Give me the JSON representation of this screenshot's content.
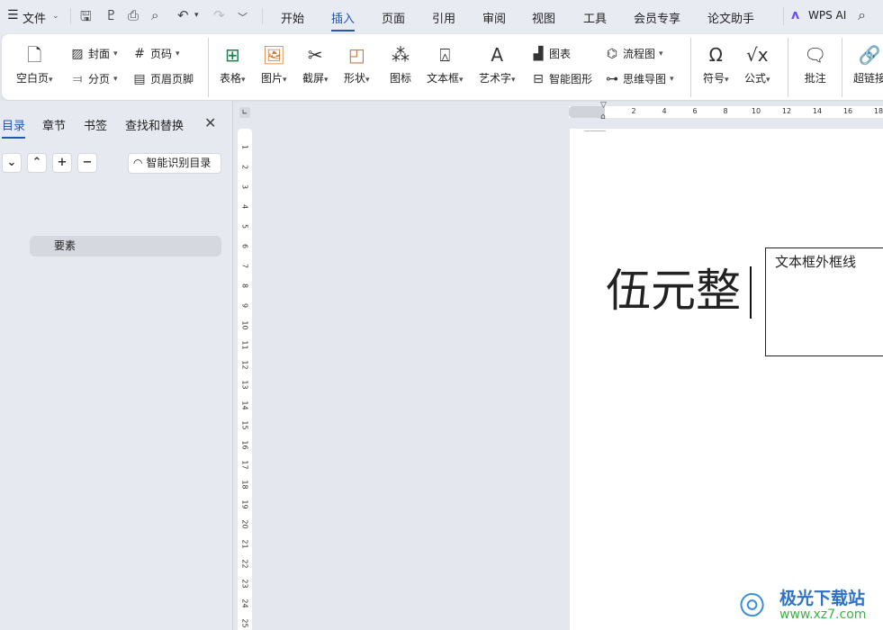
{
  "topbar": {
    "menu_icon": "hamburger-icon",
    "file_label": "文件",
    "tabs": [
      "开始",
      "插入",
      "页面",
      "引用",
      "审阅",
      "视图",
      "工具",
      "会员专享",
      "论文助手"
    ],
    "active_tab": "插入",
    "ai_label": "WPS AI",
    "accent": "#2356b8"
  },
  "ribbon": {
    "blank_page": "空白页",
    "cover": "封面",
    "page_break": "分页",
    "page_number": "页码",
    "header_footer": "页眉页脚",
    "table": "表格",
    "picture": "图片",
    "screenshot": "截屏",
    "shape": "形状",
    "icon": "图标",
    "textbox": "文本框",
    "wordart": "艺术字",
    "chart": "图表",
    "smart_art": "智能图形",
    "flowchart": "流程图",
    "mindmap": "思维导图",
    "symbol": "符号",
    "formula": "公式",
    "comment": "批注",
    "hyperlink": "超链接"
  },
  "panel": {
    "tabs": [
      "目录",
      "章节",
      "书签",
      "查找和替换"
    ],
    "active_tab": "目录",
    "smart_toc": "智能识别目录",
    "toc_item": "要素"
  },
  "ruler": {
    "horizontal": [
      "2",
      "4",
      "6",
      "8",
      "10",
      "12",
      "14",
      "16",
      "18"
    ],
    "vertical": [
      "1",
      "2",
      "3",
      "4",
      "5",
      "6",
      "7",
      "8",
      "9",
      "10",
      "11",
      "12",
      "13",
      "14",
      "15",
      "16",
      "17",
      "18",
      "19",
      "20",
      "21",
      "22",
      "23",
      "24",
      "25"
    ]
  },
  "document": {
    "body_text": "伍元整",
    "textbox_text": "文本框外框线"
  },
  "watermark": {
    "name": "极光下载站",
    "url": "www.xz7.com"
  }
}
